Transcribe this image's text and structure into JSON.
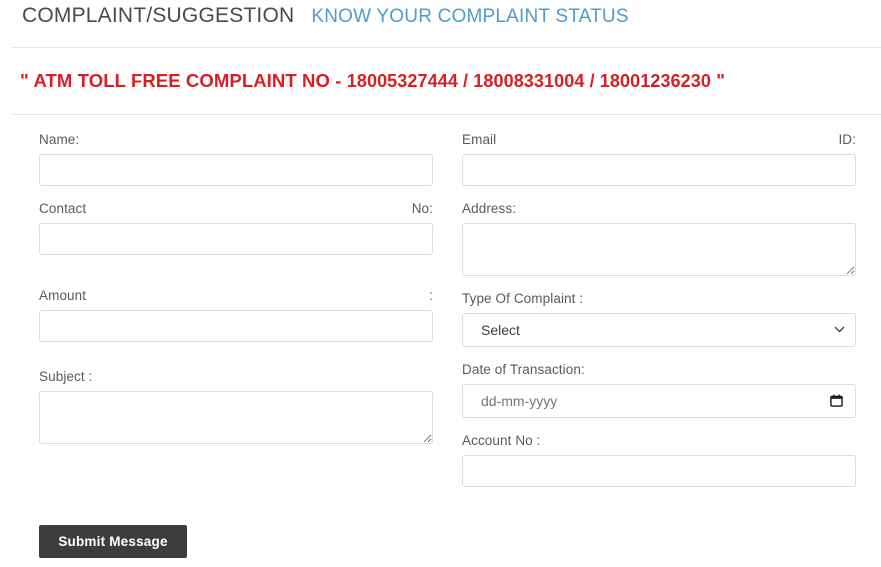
{
  "header": {
    "title": "COMPLAINT/SUGGESTION",
    "status_link": "KNOW YOUR COMPLAINT STATUS",
    "link_color": "#4f9ccc",
    "title_color": "#4a4a4a"
  },
  "banner": {
    "quote_open": "\"",
    "text": "ATM TOLL FREE COMPLAINT NO -",
    "numbers": "18005327444 / 18008331004 / 18001236230",
    "quote_close": "\"",
    "full_text": "\" ATM TOLL FREE COMPLAINT NO - 18005327444 / 18008331004 / 18001236230 \"",
    "color": "#d81f26"
  },
  "form": {
    "left": {
      "name": {
        "label": "Name:",
        "value": "",
        "placeholder": ""
      },
      "contact": {
        "label_start": "Contact",
        "label_end": "No:",
        "value": "",
        "placeholder": ""
      },
      "amount": {
        "label_start": "Amount",
        "label_end": ":",
        "value": "",
        "placeholder": ""
      },
      "subject": {
        "label": "Subject :",
        "value": "",
        "placeholder": ""
      }
    },
    "right": {
      "email": {
        "label_start": "Email",
        "label_end": "ID:",
        "value": "",
        "placeholder": ""
      },
      "address": {
        "label": "Address:",
        "value": "",
        "placeholder": ""
      },
      "complaint_type": {
        "label": "Type Of Complaint :",
        "selected": "Select",
        "options": [
          "Select"
        ]
      },
      "date_of_transaction": {
        "label": "Date of Transaction:",
        "value": "",
        "placeholder": "dd-mm-yyyy"
      },
      "account_no": {
        "label": "Account No :",
        "value": "",
        "placeholder": ""
      }
    }
  },
  "actions": {
    "submit_label": "Submit Message",
    "submit_color": "#3c3c3c"
  }
}
